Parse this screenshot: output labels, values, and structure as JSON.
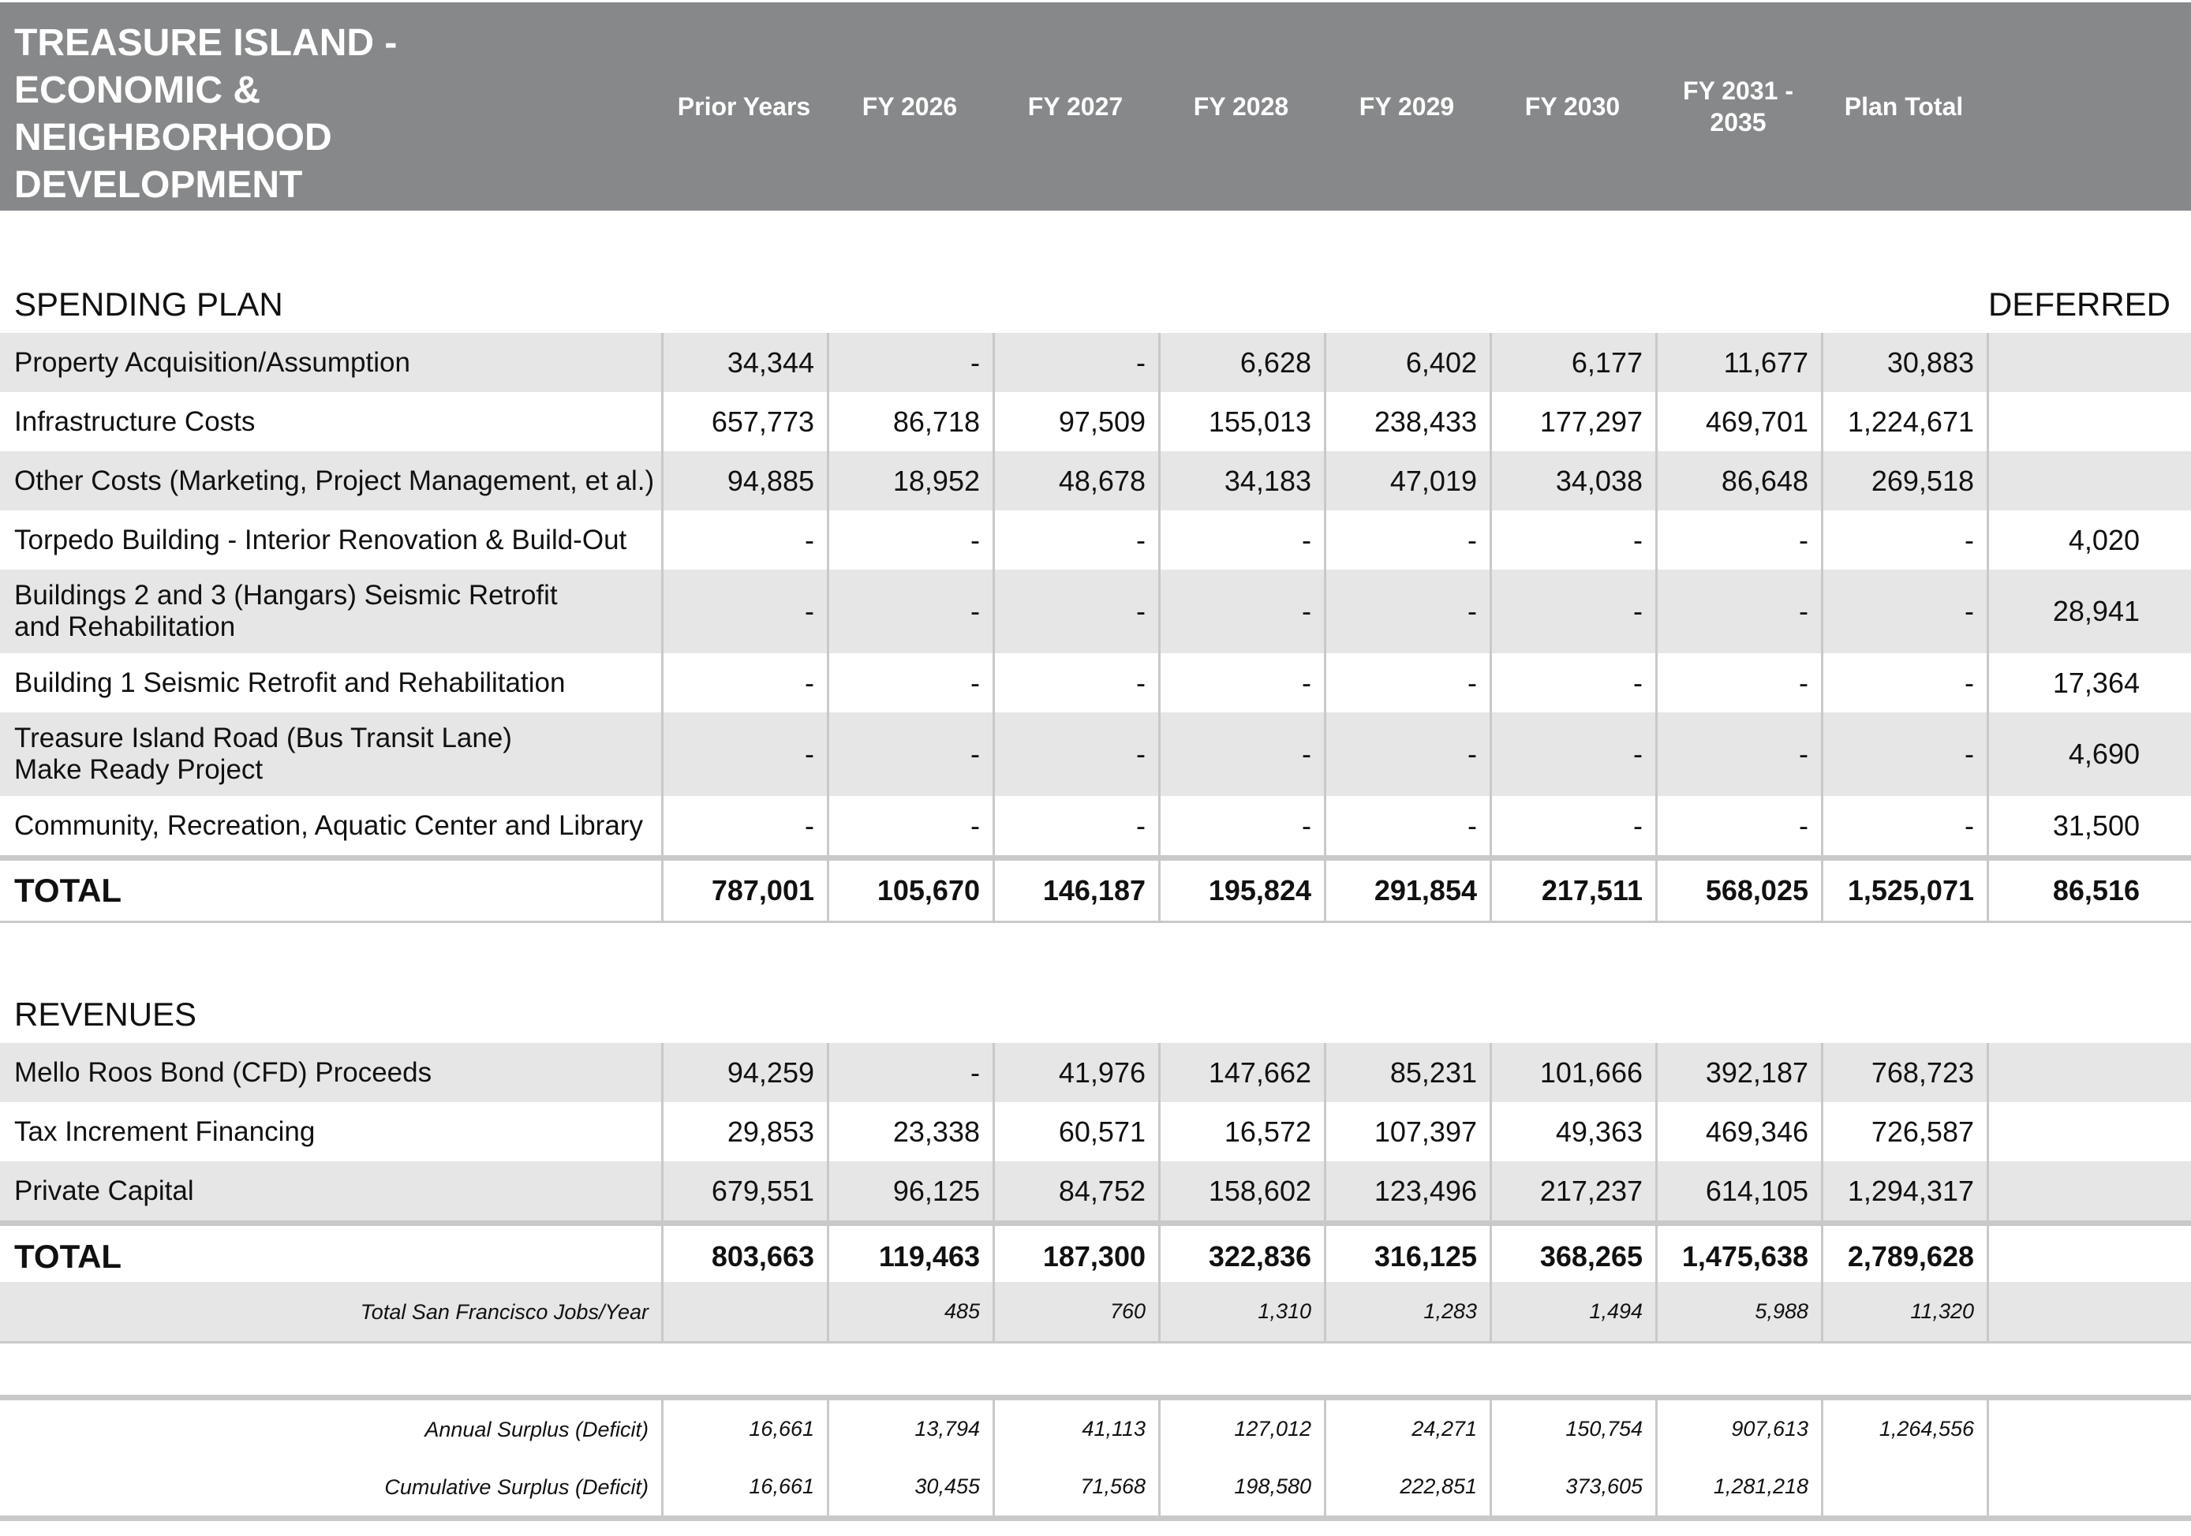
{
  "header": {
    "title": "TREASURE ISLAND -\nECONOMIC &\nNEIGHBORHOOD\nDEVELOPMENT",
    "columns": [
      "Prior Years",
      "FY 2026",
      "FY 2027",
      "FY 2028",
      "FY 2029",
      "FY 2030",
      "FY 2031 -\n2035",
      "Plan Total"
    ]
  },
  "spending": {
    "heading": "SPENDING PLAN",
    "deferred_label": "DEFERRED",
    "rows": [
      {
        "label": "Property Acquisition/Assumption",
        "values": [
          "34,344",
          "-",
          "-",
          "6,628",
          "6,402",
          "6,177",
          "11,677",
          "30,883",
          ""
        ]
      },
      {
        "label": "Infrastructure Costs",
        "values": [
          "657,773",
          "86,718",
          "97,509",
          "155,013",
          "238,433",
          "177,297",
          "469,701",
          "1,224,671",
          ""
        ]
      },
      {
        "label": "Other Costs (Marketing, Project Management, et al.)",
        "values": [
          "94,885",
          "18,952",
          "48,678",
          "34,183",
          "47,019",
          "34,038",
          "86,648",
          "269,518",
          ""
        ]
      },
      {
        "label": "Torpedo Building - Interior Renovation & Build-Out",
        "values": [
          "-",
          "-",
          "-",
          "-",
          "-",
          "-",
          "-",
          "-",
          "4,020"
        ]
      },
      {
        "label_line1": "Buildings 2 and 3 (Hangars) Seismic Retrofit",
        "label_line2": "and Rehabilitation",
        "values": [
          "-",
          "-",
          "-",
          "-",
          "-",
          "-",
          "-",
          "-",
          "28,941"
        ]
      },
      {
        "label": "Building 1 Seismic Retrofit and Rehabilitation",
        "values": [
          "-",
          "-",
          "-",
          "-",
          "-",
          "-",
          "-",
          "-",
          "17,364"
        ]
      },
      {
        "label_line1": "Treasure Island Road (Bus Transit Lane)",
        "label_line2": "Make Ready Project",
        "values": [
          "-",
          "-",
          "-",
          "-",
          "-",
          "-",
          "-",
          "-",
          "4,690"
        ]
      },
      {
        "label": "Community, Recreation, Aquatic Center and Library",
        "values": [
          "-",
          "-",
          "-",
          "-",
          "-",
          "-",
          "-",
          "-",
          "31,500"
        ]
      }
    ],
    "total": {
      "label": "TOTAL",
      "values": [
        "787,001",
        "105,670",
        "146,187",
        "195,824",
        "291,854",
        "217,511",
        "568,025",
        "1,525,071",
        "86,516"
      ]
    }
  },
  "revenues": {
    "heading": "REVENUES",
    "rows": [
      {
        "label": "Mello Roos Bond (CFD) Proceeds",
        "values": [
          "94,259",
          "-",
          "41,976",
          "147,662",
          "85,231",
          "101,666",
          "392,187",
          "768,723",
          ""
        ]
      },
      {
        "label": "Tax Increment Financing",
        "values": [
          "29,853",
          "23,338",
          "60,571",
          "16,572",
          "107,397",
          "49,363",
          "469,346",
          "726,587",
          ""
        ]
      },
      {
        "label": "Private Capital",
        "values": [
          "679,551",
          "96,125",
          "84,752",
          "158,602",
          "123,496",
          "217,237",
          "614,105",
          "1,294,317",
          ""
        ]
      }
    ],
    "total": {
      "label": "TOTAL",
      "values": [
        "803,663",
        "119,463",
        "187,300",
        "322,836",
        "316,125",
        "368,265",
        "1,475,638",
        "2,789,628",
        ""
      ]
    },
    "jobs": {
      "label": "Total San Francisco Jobs/Year",
      "values": [
        "",
        "485",
        "760",
        "1,310",
        "1,283",
        "1,494",
        "5,988",
        "11,320",
        ""
      ]
    }
  },
  "surplus": {
    "annual": {
      "label": "Annual Surplus (Deficit)",
      "values": [
        "16,661",
        "13,794",
        "41,113",
        "127,012",
        "24,271",
        "150,754",
        "907,613",
        "1,264,556",
        ""
      ]
    },
    "cumulative": {
      "label": "Cumulative Surplus (Deficit)",
      "values": [
        "16,661",
        "30,455",
        "71,568",
        "198,580",
        "222,851",
        "373,605",
        "1,281,218",
        "",
        ""
      ]
    }
  }
}
